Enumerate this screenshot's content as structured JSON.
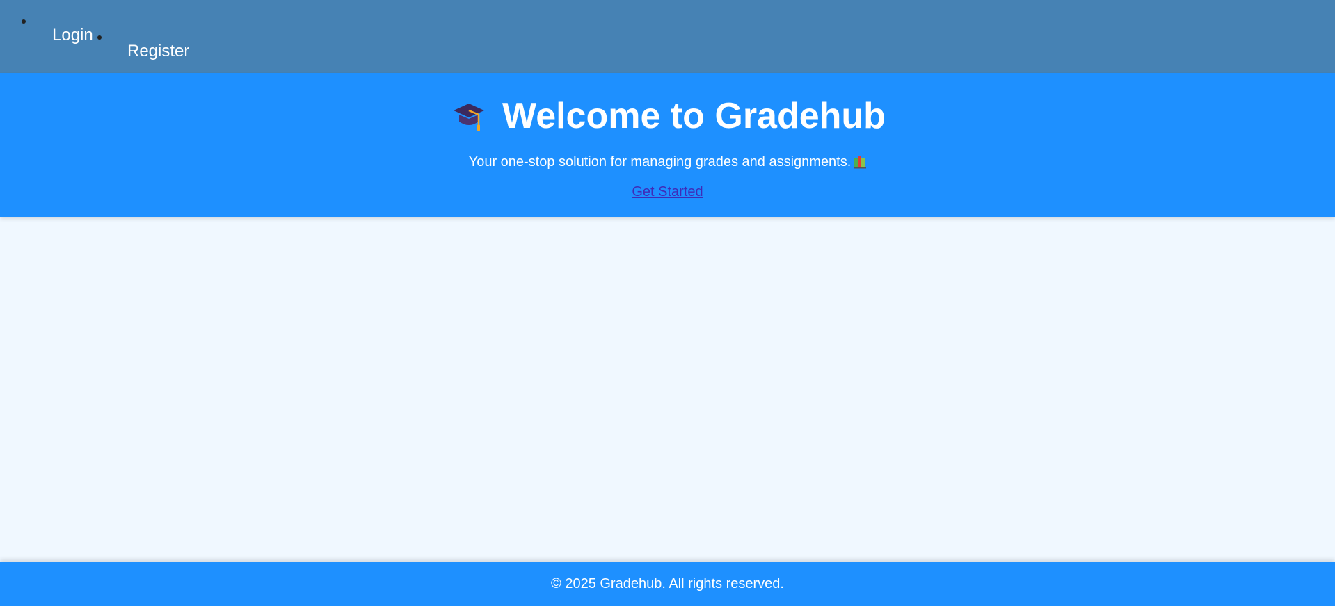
{
  "nav": {
    "items": [
      {
        "label": "Login"
      },
      {
        "label": "Register"
      }
    ]
  },
  "hero": {
    "icon": "graduation-cap-icon",
    "title": "Welcome to Gradehub",
    "subtitle": "Your one-stop solution for managing grades and assignments.",
    "subtitle_icon": "books-icon",
    "cta_label": "Get Started"
  },
  "footer": {
    "text": "© 2025 Gradehub. All rights reserved."
  },
  "colors": {
    "nav_bg": "#4682b4",
    "hero_bg": "#1e90ff",
    "page_bg": "#f0f8ff",
    "footer_bg": "#1e90ff",
    "link": "#3f2bb8"
  }
}
